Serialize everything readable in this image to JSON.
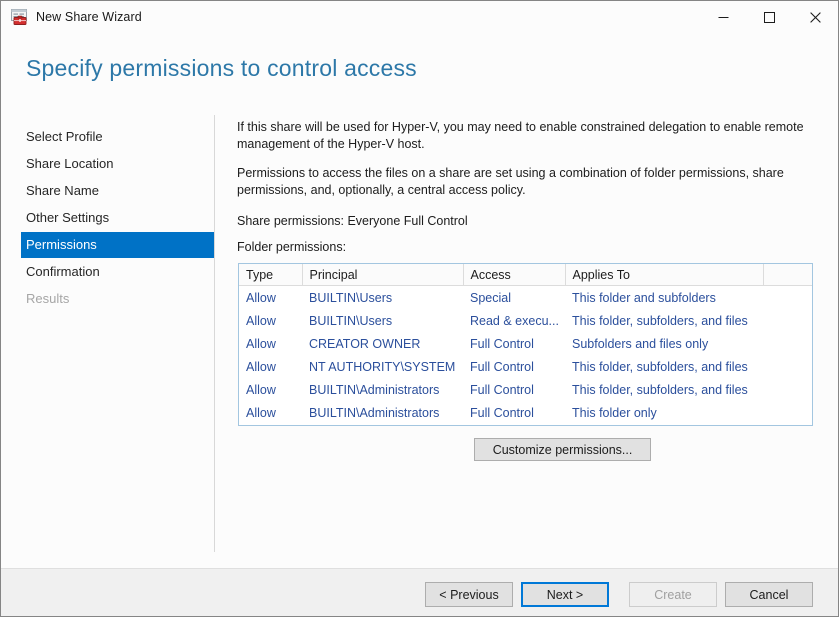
{
  "window": {
    "title": "New Share Wizard",
    "app_icon": "server-manager-icon",
    "controls": {
      "minimize": "minimize-icon",
      "maximize": "maximize-icon",
      "close": "close-icon"
    }
  },
  "header": {
    "title": "Specify permissions to control access",
    "title_color": "#2d78a8"
  },
  "sidebar": {
    "selected_index": 4,
    "accent_color": "#0072c6",
    "items": [
      {
        "label": "Select Profile",
        "state": "completed"
      },
      {
        "label": "Share Location",
        "state": "completed"
      },
      {
        "label": "Share Name",
        "state": "completed"
      },
      {
        "label": "Other Settings",
        "state": "completed"
      },
      {
        "label": "Permissions",
        "state": "selected"
      },
      {
        "label": "Confirmation",
        "state": "normal"
      },
      {
        "label": "Results",
        "state": "disabled"
      }
    ]
  },
  "content": {
    "paragraph1": "If this share will be used for Hyper-V, you may need to enable constrained delegation to enable remote management of the Hyper-V host.",
    "paragraph2": "Permissions to access the files on a share are set using a combination of folder permissions, share permissions, and, optionally, a central access policy.",
    "share_permissions_label": "Share permissions: Everyone Full Control",
    "folder_permissions_label": "Folder permissions:",
    "customize_button": "Customize permissions...",
    "table": {
      "columns": [
        "Type",
        "Principal",
        "Access",
        "Applies To",
        ""
      ],
      "row_text_color": "#2b4f9c",
      "rows": [
        {
          "type": "Allow",
          "principal": "BUILTIN\\Users",
          "access": "Special",
          "applies_to": "This folder and subfolders",
          "extra": ""
        },
        {
          "type": "Allow",
          "principal": "BUILTIN\\Users",
          "access": "Read & execu...",
          "applies_to": "This folder, subfolders, and files",
          "extra": ""
        },
        {
          "type": "Allow",
          "principal": "CREATOR OWNER",
          "access": "Full Control",
          "applies_to": "Subfolders and files only",
          "extra": ""
        },
        {
          "type": "Allow",
          "principal": "NT AUTHORITY\\SYSTEM",
          "access": "Full Control",
          "applies_to": "This folder, subfolders, and files",
          "extra": ""
        },
        {
          "type": "Allow",
          "principal": "BUILTIN\\Administrators",
          "access": "Full Control",
          "applies_to": "This folder, subfolders, and files",
          "extra": ""
        },
        {
          "type": "Allow",
          "principal": "BUILTIN\\Administrators",
          "access": "Full Control",
          "applies_to": "This folder only",
          "extra": ""
        }
      ]
    }
  },
  "footer": {
    "previous": "< Previous",
    "next": "Next >",
    "create": "Create",
    "cancel": "Cancel",
    "next_focused": true,
    "create_disabled": true
  }
}
